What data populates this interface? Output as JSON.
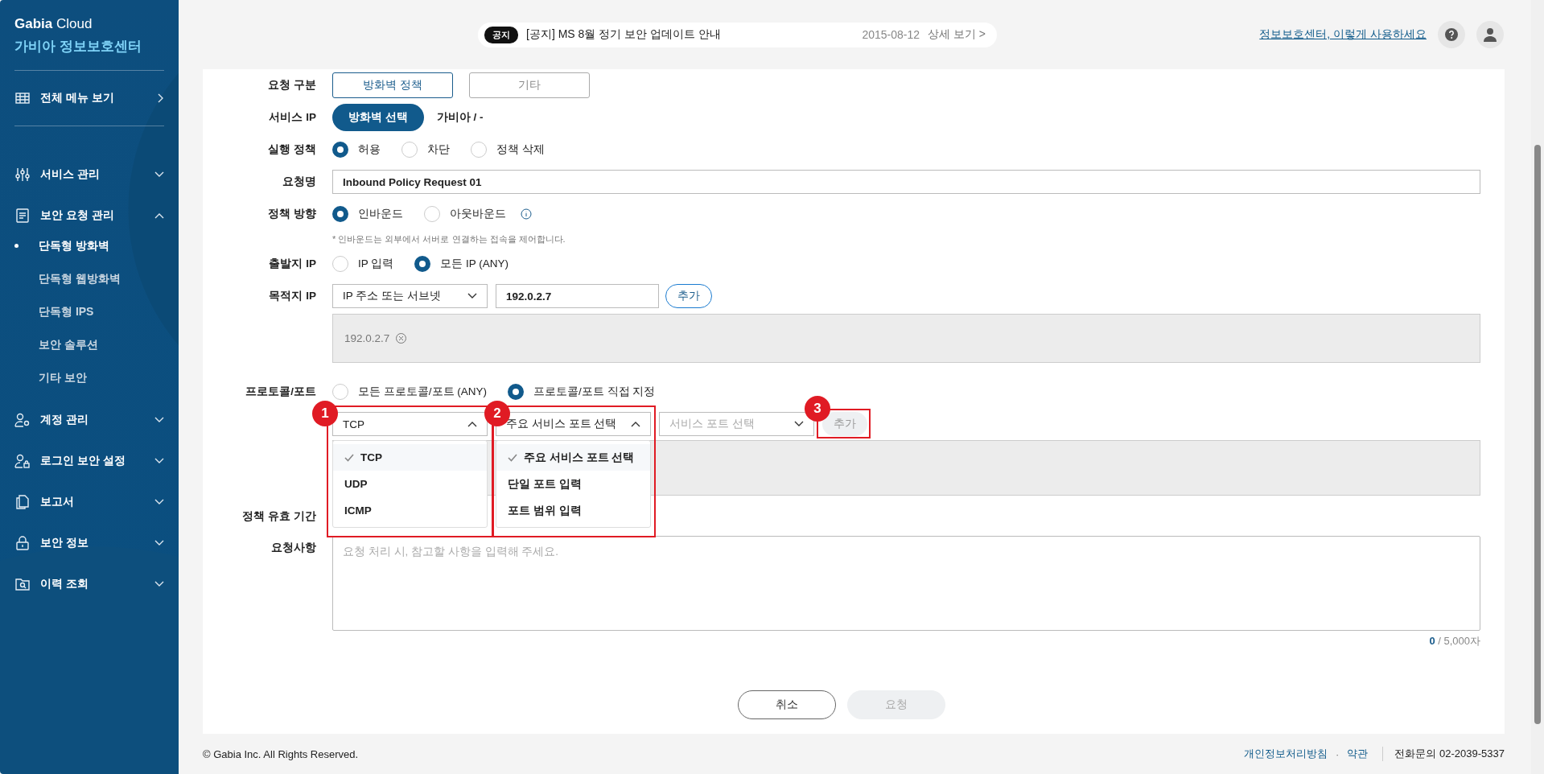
{
  "header": {
    "notice": {
      "badge": "공지",
      "title": "[공지] MS 8월 정기 보안 업데이트 안내",
      "date": "2015-08-12",
      "more": "상세 보기 >"
    },
    "help_link": "정보보호센터, 이렇게 사용하세요"
  },
  "sidebar": {
    "brand": "**Gabia** Cloud",
    "title": "가비아 정보보호센터",
    "all_menu": "전체 메뉴 보기",
    "items": [
      {
        "label": "서비스 관리",
        "expanded": false
      },
      {
        "label": "보안 요청 관리",
        "expanded": true,
        "children": [
          {
            "label": "단독형 방화벽",
            "selected": true
          },
          {
            "label": "단독형 웹방화벽",
            "selected": false
          },
          {
            "label": "단독형 IPS",
            "selected": false
          },
          {
            "label": "보안 솔루션",
            "selected": false
          },
          {
            "label": "기타 보안",
            "selected": false
          }
        ]
      },
      {
        "label": "계정 관리",
        "expanded": false
      },
      {
        "label": "로그인 보안 설정",
        "expanded": false
      },
      {
        "label": "보고서",
        "expanded": false
      },
      {
        "label": "보안 정보",
        "expanded": false
      },
      {
        "label": "이력 조회",
        "expanded": false
      }
    ]
  },
  "form": {
    "request_type": {
      "label": "요청 구분",
      "options": [
        {
          "label": "방화벽 정책",
          "selected": true
        },
        {
          "label": "기타",
          "selected": false
        }
      ]
    },
    "service_ip": {
      "label": "서비스 IP",
      "button": "방화벽 선택",
      "value": "가비아 / -"
    },
    "action": {
      "label": "실행 정책",
      "options": [
        {
          "label": "허용",
          "selected": true
        },
        {
          "label": "차단",
          "selected": false
        },
        {
          "label": "정책 삭제",
          "selected": false
        }
      ]
    },
    "request_name": {
      "label": "요청명",
      "value": "Inbound Policy Request 01"
    },
    "direction": {
      "label": "정책 방향",
      "options": [
        {
          "label": "인바운드",
          "selected": true
        },
        {
          "label": "아웃바운드",
          "selected": false
        }
      ],
      "note": "* 인바운드는 외부에서 서버로 연결하는 접속을 제어합니다."
    },
    "source_ip": {
      "label": "출발지 IP",
      "options": [
        {
          "label": "IP 입력",
          "selected": false
        },
        {
          "label": "모든 IP (ANY)",
          "selected": true
        }
      ]
    },
    "dest_ip": {
      "label": "목적지 IP",
      "type_select": "IP 주소 또는 서브넷",
      "value": "192.0.2.7",
      "add": "추가",
      "tags": [
        "192.0.2.7"
      ]
    },
    "protocol": {
      "label": "프로토콜/포트",
      "options": [
        {
          "label": "모든 프로토콜/포트 (ANY)",
          "selected": false
        },
        {
          "label": "프로토콜/포트 직접 지정",
          "selected": true
        }
      ],
      "protocol_select": {
        "value": "TCP",
        "expanded": true,
        "options": [
          {
            "label": "TCP",
            "selected": true
          },
          {
            "label": "UDP",
            "selected": false
          },
          {
            "label": "ICMP",
            "selected": false
          }
        ]
      },
      "port_select": {
        "value": "주요 서비스 포트 선택",
        "expanded": true,
        "options": [
          {
            "label": "주요 서비스 포트 선택",
            "selected": true
          },
          {
            "label": "단일 포트 입력",
            "selected": false
          },
          {
            "label": "포트 범위 입력",
            "selected": false
          }
        ]
      },
      "service_select": {
        "placeholder": "서비스 포트 선택",
        "disabled": true
      },
      "add": {
        "label": "추가",
        "disabled": true
      }
    },
    "period": {
      "label": "정책 유효 기간"
    },
    "memo": {
      "label": "요청사항",
      "placeholder": "요청 처리 시, 참고할 사항을 입력해 주세요.",
      "count": "0",
      "limit": "/ 5,000자"
    },
    "actions": [
      {
        "label": "취소",
        "disabled": false
      },
      {
        "label": "요청",
        "disabled": true
      }
    ]
  },
  "annotations": [
    {
      "number": "1"
    },
    {
      "number": "2"
    },
    {
      "number": "3"
    }
  ],
  "footer": {
    "copyright": "© Gabia Inc. All Rights Reserved.",
    "links": [
      "개인정보처리방침",
      "약관"
    ],
    "separator": "·",
    "phone": "전화문의 02-2039-5337"
  }
}
